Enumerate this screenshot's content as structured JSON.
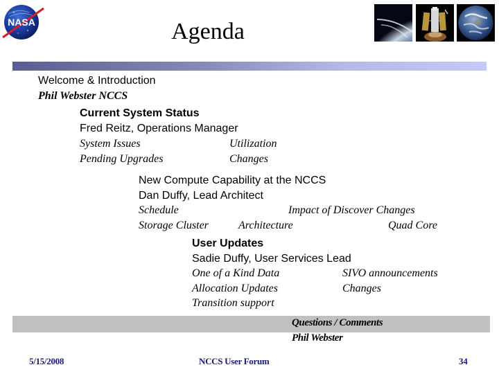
{
  "slide": {
    "title": "Agenda",
    "logo": {
      "icon": "nasa-meatball-logo",
      "text": "NASA"
    },
    "header_photos": [
      {
        "icon": "earth-limb-photo"
      },
      {
        "icon": "hubble-telescope-photo"
      },
      {
        "icon": "full-earth-photo"
      }
    ],
    "colors": {
      "header_bar_start": "#5c5c90",
      "header_bar_end": "#c8c8f8",
      "qa_band": "#c0c0c0",
      "footer_text": "#1a1a7a"
    },
    "sections": [
      {
        "heading": "Welcome & Introduction",
        "presenter": "Phil Webster  NCCS"
      },
      {
        "heading": "Current System Status",
        "presenter": "Fred Reitz, Operations Manager",
        "topics": [
          [
            "System Issues",
            "Utilization"
          ],
          [
            "Pending Upgrades",
            "Changes"
          ]
        ]
      },
      {
        "heading": "New Compute Capability at the NCCS",
        "presenter": "Dan Duffy, Lead Architect",
        "topics": [
          [
            "Schedule",
            "Impact of Discover Changes"
          ],
          [
            "Storage Cluster",
            "Architecture",
            "Quad Core"
          ]
        ]
      },
      {
        "heading": "User Updates",
        "presenter": "Sadie Duffy, User Services Lead",
        "topics": [
          [
            "One of a Kind Data",
            "SIVO announcements"
          ],
          [
            "Allocation Updates",
            "Changes"
          ],
          [
            "Transition support"
          ]
        ]
      },
      {
        "heading": "Questions / Comments",
        "presenter": "Phil Webster"
      }
    ],
    "footer": {
      "date": "5/15/2008",
      "event": "NCCS User Forum",
      "page_number": "34"
    }
  }
}
